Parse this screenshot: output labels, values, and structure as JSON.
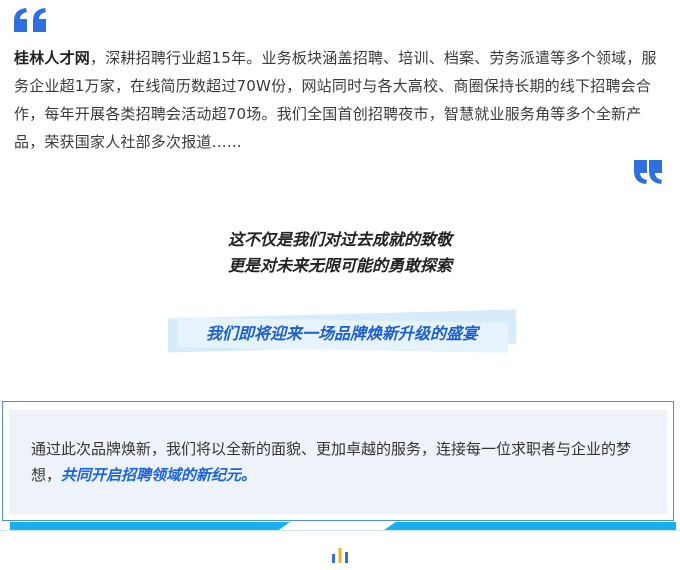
{
  "intro": {
    "brand": "桂林人才网",
    "text": "，深耕招聘行业超15年。业务板块涵盖招聘、培训、档案、劳务派遣等多个领域，服务企业超1万家，在线简历数超过70W份，网站同时与各大高校、商圈保持长期的线下招聘会合作，每年开展各类招聘会活动超70场。我们全国首创招聘夜市，智慧就业服务角等多个全新产品，荣获国家人社部多次报道……"
  },
  "slogan": {
    "line1": "这不仅是我们对过去成就的致敬",
    "line2": "更是对未来无限可能的勇敢探索"
  },
  "banner": {
    "text": "我们即将迎来一场品牌焕新升级的盛宴"
  },
  "card": {
    "text": "通过此次品牌焕新，我们将以全新的面貌、更加卓越的服务，连接每一位求职者与企业的梦想，",
    "highlight": "共同开启招聘领域的新纪元。"
  },
  "colors": {
    "accent": "#1b64e0",
    "quote": "#2f6fe0",
    "deco": "#1ab0f0",
    "banner_bg": "#d6ecfb",
    "card_border": "#4a90e2"
  },
  "icons": [
    "quote-open-icon",
    "quote-close-icon",
    "bar-chart-icon"
  ]
}
